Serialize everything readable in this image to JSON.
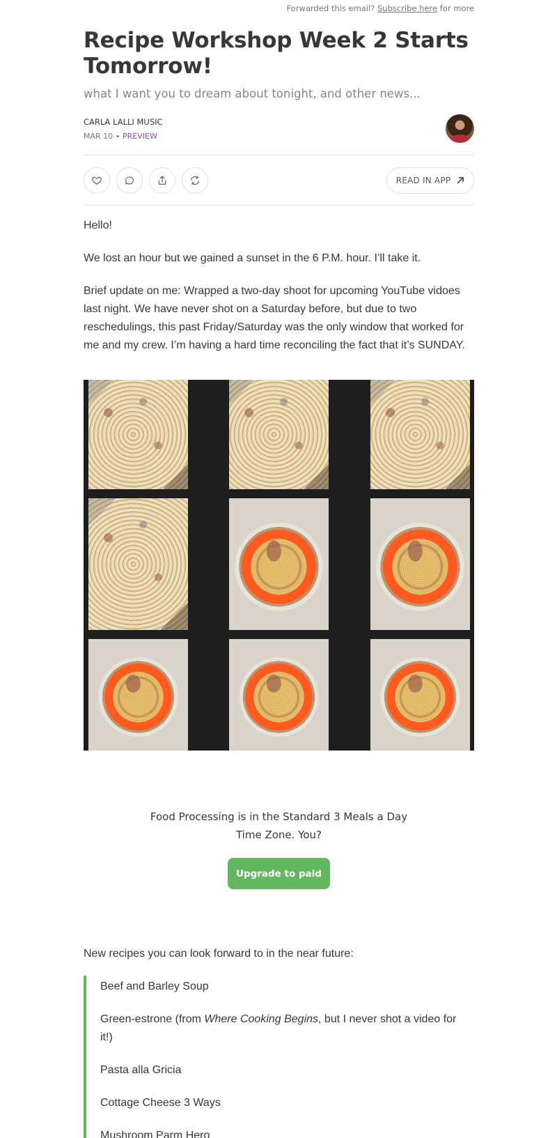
{
  "top_note": {
    "prefix": "Forwarded this email?",
    "link": "Subscribe here",
    "suffix": "for more"
  },
  "post": {
    "title": "Recipe Workshop Week 2 Starts Tomorrow!",
    "subtitle": "what I want you to dream about tonight, and other news...",
    "author": "CARLA LALLI MUSIC",
    "date": "MAR 10",
    "separator": "∙",
    "preview_label": "PREVIEW"
  },
  "actions": {
    "icons": [
      "heart-icon",
      "comment-icon",
      "share-icon",
      "restack-icon"
    ],
    "read_in_app": "READ IN APP"
  },
  "body": {
    "p1": "Hello!",
    "p2": "We lost an hour but we gained a sunset in the 6 P.M. hour. I’ll take it.",
    "p3": "Brief update on me: Wrapped a two-day shoot for upcoming YouTube vidoes last night. We have never shot on a Saturday before, but due to two reschedulings, this past Friday/Saturday was the only window that worked for me and my crew. I’m having a hard time reconciling the fact that it’s SUNDAY."
  },
  "image_grid": {
    "cells": [
      "pasta-pan",
      "pasta-pan",
      "pasta-pan",
      "pasta-pan",
      "pasta-plate",
      "pasta-plate",
      "pasta-plate",
      "pasta-plate",
      "pasta-plate"
    ]
  },
  "cta": {
    "line1": "Food Processing is in the Standard 3 Meals a Day",
    "line2": "Time Zone. You?",
    "button": "Upgrade to paid"
  },
  "recipes": {
    "intro": "New recipes you can look forward to in the near future:",
    "items": [
      "Beef and Barley Soup",
      "Green-estrone (from ",
      "Pasta alla Gricia",
      "Cottage Cheese 3 Ways",
      "Mushroom Parm Hero"
    ],
    "item2_book": "Where Cooking Begins",
    "item2_rest": ", but I never shot a video for it!)"
  },
  "colors": {
    "text": "#363737",
    "accent_green": "#63b85f",
    "preview_purple": "#7a4de0",
    "image_background": "#1e1e1e"
  }
}
